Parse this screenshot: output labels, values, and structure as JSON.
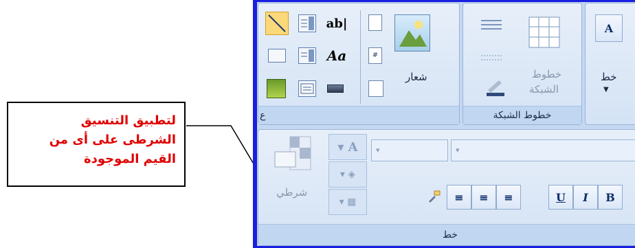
{
  "callout": {
    "lines": [
      "لتطبيق التنسيق",
      "الشرطى على أى من",
      "القيم الموجودة"
    ]
  },
  "ribbon": {
    "groups": {
      "gridlines": {
        "caption": "خطوط الشبكة",
        "button_label_1": "خطوط",
        "button_label_2": "الشبكة"
      },
      "controls": {
        "caption": "ع",
        "logo_label": "شعار",
        "textbox_glyph": "ab|",
        "label_glyph": "Aa"
      },
      "font_top": {
        "button_label": "خط",
        "glyph": "A"
      },
      "font": {
        "caption": "خط",
        "conditional_label": "شرطي"
      }
    },
    "format_buttons": {
      "bold": "B",
      "italic": "I",
      "underline": "U"
    }
  },
  "colors": {
    "callout_text": "#e00000",
    "frame": "#1a1ee0",
    "ribbon_bg": "#c4d8f2"
  }
}
